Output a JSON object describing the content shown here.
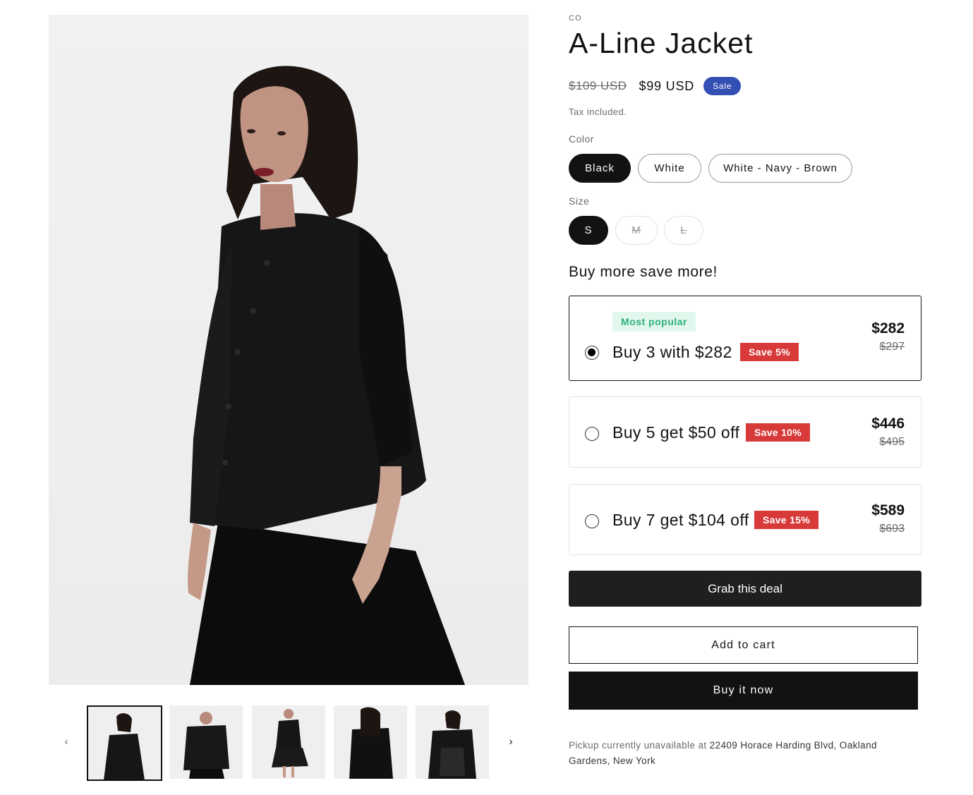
{
  "product": {
    "vendor": "CO",
    "title": "A-Line Jacket",
    "price_compare": "$109 USD",
    "price_sale": "$99 USD",
    "sale_badge": "Sale",
    "tax_note": "Tax included."
  },
  "options": {
    "color_label": "Color",
    "colors": [
      "Black",
      "White",
      "White - Navy - Brown"
    ],
    "selected_color": "Black",
    "size_label": "Size",
    "sizes": [
      "S",
      "M",
      "L"
    ],
    "selected_size": "S",
    "unavailable_sizes": [
      "M",
      "L"
    ]
  },
  "bundles": {
    "heading": "Buy more save more!",
    "items": [
      {
        "popular_tag": "Most popular",
        "label": "Buy 3 with $282",
        "save": "Save 5%",
        "price": "$282",
        "old_price": "$297",
        "selected": true
      },
      {
        "label": "Buy 5 get $50 off",
        "save": "Save 10%",
        "price": "$446",
        "old_price": "$495",
        "selected": false
      },
      {
        "label": "Buy 7 get $104 off",
        "save": "Save 15%",
        "price": "$589",
        "old_price": "$693",
        "selected": false
      }
    ]
  },
  "actions": {
    "deal": "Grab this deal",
    "add_to_cart": "Add to cart",
    "buy_now": "Buy it now"
  },
  "pickup": {
    "prefix": "Pickup currently unavailable at ",
    "address": "22409 Horace Harding Blvd, Oakland Gardens, New York"
  },
  "gallery": {
    "thumbnail_count": 5,
    "active_thumbnail": 1,
    "prev_icon": "chevron-left-icon",
    "next_icon": "chevron-right-icon"
  },
  "colors": {
    "sale_badge": "#334fb4",
    "save_tag": "#d83a3a",
    "popular_bg": "#e2f7ee",
    "popular_text": "#2fb07a",
    "primary_button": "#121212"
  }
}
